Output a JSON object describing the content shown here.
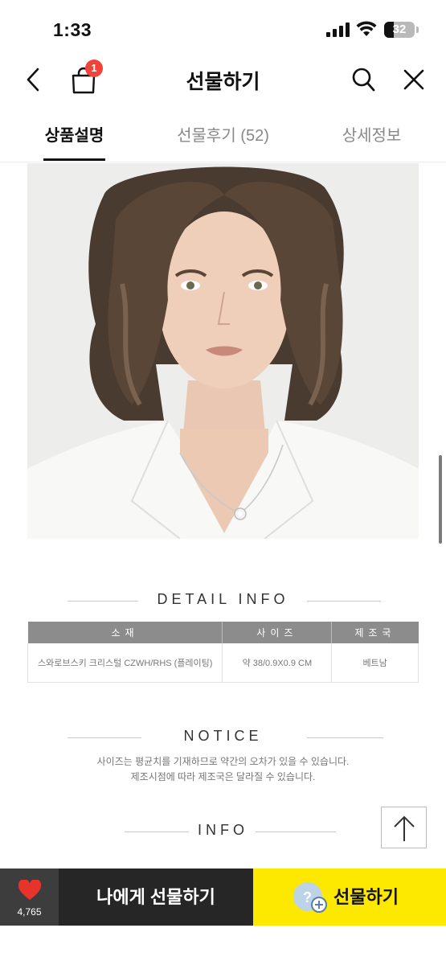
{
  "status_bar": {
    "time": "1:33",
    "battery": "32"
  },
  "header": {
    "title": "선물하기",
    "cart_badge": "1"
  },
  "tabs": [
    {
      "label": "상품설명",
      "active": true
    },
    {
      "label": "선물후기 (52)",
      "active": false
    },
    {
      "label": "상세정보",
      "active": false
    }
  ],
  "detail_info": {
    "heading": "DETAIL INFO",
    "columns": [
      "소재",
      "사이즈",
      "제조국"
    ],
    "row": [
      "스와로브스키 크리스털 CZWH/RHS (플레이팅)",
      "약 38/0.9X0.9 CM",
      "베트남"
    ]
  },
  "notice": {
    "heading": "NOTICE",
    "lines": [
      "사이즈는 평균치를 기재하므로 약간의 오차가 있을 수 있습니다.",
      "제조시점에 따라 제조국은 달라질 수 있습니다."
    ]
  },
  "info": {
    "heading": "INFO"
  },
  "bottom_bar": {
    "like_count": "4,765",
    "gift_to_me": "나에게 선물하기",
    "gift": "선물하기",
    "like_color": "#e8322c",
    "gift_color": "#fde800"
  }
}
